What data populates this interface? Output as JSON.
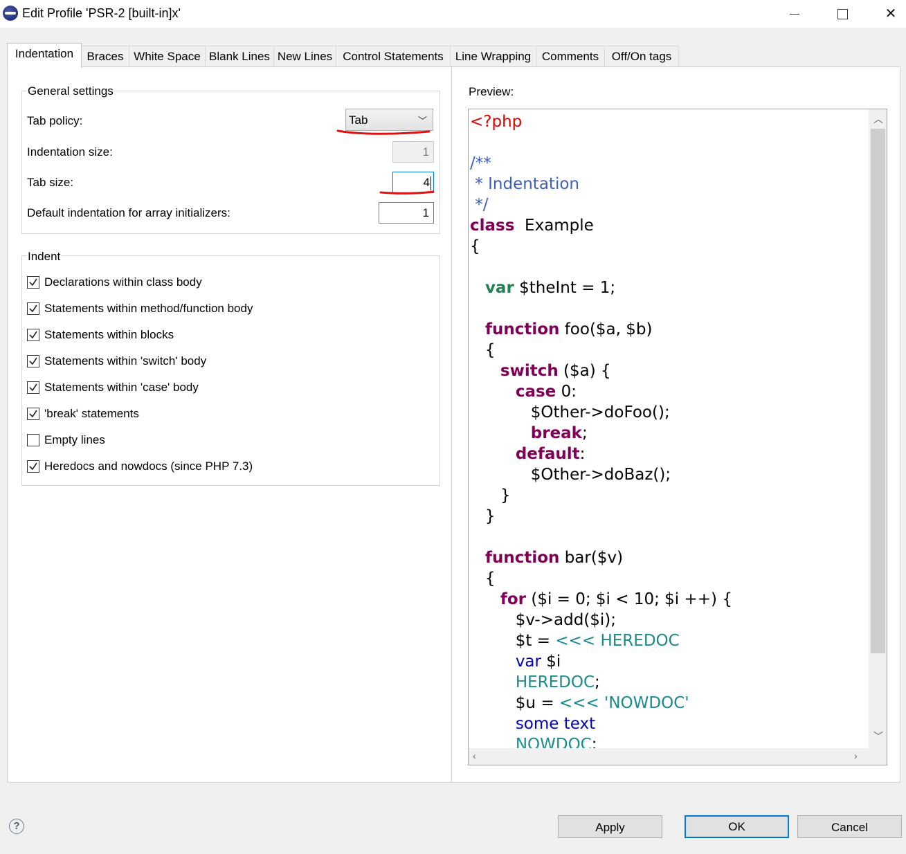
{
  "window": {
    "title": "Edit Profile 'PSR-2 [built-in]x'"
  },
  "tabs": [
    "Indentation",
    "Braces",
    "White Space",
    "Blank Lines",
    "New Lines",
    "Control Statements",
    "Line Wrapping",
    "Comments",
    "Off/On tags"
  ],
  "active_tab": "Indentation",
  "general": {
    "title": "General settings",
    "tab_policy_label": "Tab policy:",
    "tab_policy_value": "Tab",
    "indentation_size_label": "Indentation size:",
    "indentation_size_value": "1",
    "tab_size_label": "Tab size:",
    "tab_size_value": "4",
    "array_init_label": "Default indentation for array initializers:",
    "array_init_value": "1"
  },
  "indent": {
    "title": "Indent",
    "options": [
      {
        "label": "Declarations within class body",
        "checked": true
      },
      {
        "label": "Statements within method/function body",
        "checked": true
      },
      {
        "label": "Statements within blocks",
        "checked": true
      },
      {
        "label": "Statements within 'switch' body",
        "checked": true
      },
      {
        "label": "Statements within 'case' body",
        "checked": true
      },
      {
        "label": "'break' statements",
        "checked": true
      },
      {
        "label": "Empty lines",
        "checked": false
      },
      {
        "label": "Heredocs and nowdocs (since PHP 7.3)",
        "checked": true
      }
    ]
  },
  "preview": {
    "label": "Preview:",
    "lines": [
      [
        [
          "php",
          "<?php"
        ]
      ],
      [],
      [
        [
          "cmt",
          "/**"
        ]
      ],
      [
        [
          "cmt",
          " * Indentation"
        ]
      ],
      [
        [
          "cmt",
          " */"
        ]
      ],
      [
        [
          "kw",
          "class"
        ],
        [
          "",
          "  Example"
        ]
      ],
      [
        [
          "",
          "{"
        ]
      ],
      [],
      [
        [
          "",
          "   "
        ],
        [
          "kwg",
          "var"
        ],
        [
          "",
          " $theInt = 1;"
        ]
      ],
      [],
      [
        [
          "",
          "   "
        ],
        [
          "kw",
          "function"
        ],
        [
          "",
          " foo($a, $b)"
        ]
      ],
      [
        [
          "",
          "   {"
        ]
      ],
      [
        [
          "",
          "      "
        ],
        [
          "kw",
          "switch"
        ],
        [
          "",
          " ($a) {"
        ]
      ],
      [
        [
          "",
          "         "
        ],
        [
          "kw",
          "case"
        ],
        [
          "",
          " 0:"
        ]
      ],
      [
        [
          "",
          "            $Other->doFoo();"
        ]
      ],
      [
        [
          "",
          "            "
        ],
        [
          "kw",
          "break"
        ],
        [
          "",
          ";"
        ]
      ],
      [
        [
          "",
          "         "
        ],
        [
          "kw",
          "default"
        ],
        [
          "",
          ":"
        ]
      ],
      [
        [
          "",
          "            $Other->doBaz();"
        ]
      ],
      [
        [
          "",
          "      }"
        ]
      ],
      [
        [
          "",
          "   }"
        ]
      ],
      [],
      [
        [
          "",
          "   "
        ],
        [
          "kw",
          "function"
        ],
        [
          "",
          " bar($v)"
        ]
      ],
      [
        [
          "",
          "   {"
        ]
      ],
      [
        [
          "",
          "      "
        ],
        [
          "kw",
          "for"
        ],
        [
          "",
          " ($i = 0; $i < 10; $i ++) {"
        ]
      ],
      [
        [
          "",
          "         $v->add($i);"
        ]
      ],
      [
        [
          "",
          "         $t = "
        ],
        [
          "here",
          "<<< HEREDOC"
        ]
      ],
      [
        [
          "",
          "         "
        ],
        [
          "blue",
          "var"
        ],
        [
          "",
          " $i"
        ]
      ],
      [
        [
          "",
          "         "
        ],
        [
          "here",
          "HEREDOC"
        ],
        [
          "",
          ";"
        ]
      ],
      [
        [
          "",
          "         $u = "
        ],
        [
          "here",
          "<<< 'NOWDOC'"
        ]
      ],
      [
        [
          "",
          "         "
        ],
        [
          "blue",
          "some text"
        ]
      ],
      [
        [
          "",
          "         "
        ],
        [
          "here",
          "NOWDOC"
        ],
        [
          "",
          ";"
        ]
      ]
    ]
  },
  "buttons": {
    "apply": "Apply",
    "ok": "OK",
    "cancel": "Cancel",
    "help": "?"
  }
}
